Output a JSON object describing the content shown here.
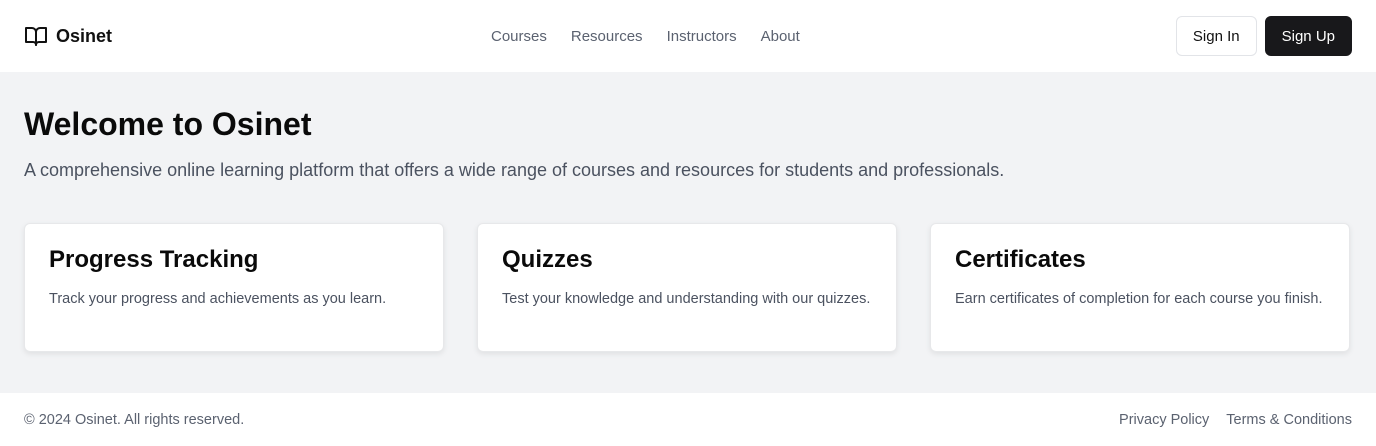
{
  "header": {
    "brand": {
      "name": "Osinet",
      "icon": "book-open-icon"
    },
    "nav": [
      {
        "label": "Courses"
      },
      {
        "label": "Resources"
      },
      {
        "label": "Instructors"
      },
      {
        "label": "About"
      }
    ],
    "sign_in_label": "Sign In",
    "sign_up_label": "Sign Up"
  },
  "main": {
    "title": "Welcome to Osinet",
    "subtitle": "A comprehensive online learning platform that offers a wide range of courses and resources for students and professionals.",
    "cards": [
      {
        "title": "Progress Tracking",
        "text": "Track your progress and achievements as you learn."
      },
      {
        "title": "Quizzes",
        "text": "Test your knowledge and understanding with our quizzes."
      },
      {
        "title": "Certificates",
        "text": "Earn certificates of completion for each course you finish."
      }
    ]
  },
  "footer": {
    "copyright": "© 2024 Osinet. All rights reserved.",
    "links": [
      {
        "label": "Privacy Policy"
      },
      {
        "label": "Terms & Conditions"
      }
    ]
  },
  "colors": {
    "primary_button": "#18181b",
    "page_background": "#f2f3f5",
    "muted_text": "#5b6270"
  }
}
